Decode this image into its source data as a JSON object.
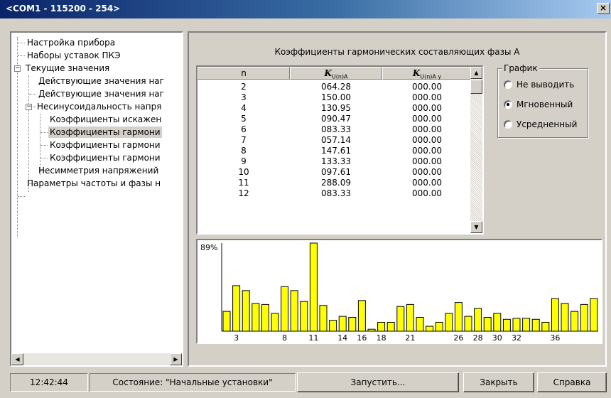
{
  "window": {
    "title": "<COM1 - 115200 - 254>",
    "close_glyph": "×"
  },
  "tree": {
    "items": [
      {
        "label": "Настройка прибора"
      },
      {
        "label": "Наборы уставок ПКЭ"
      },
      {
        "label": "Текущие значения",
        "expand": "−"
      },
      {
        "label": "Действующие значения наг"
      },
      {
        "label": "Действующие значения наг"
      },
      {
        "label": "Несинусоидальность напря",
        "expand": "−"
      },
      {
        "label": "Коэффициенты искажен"
      },
      {
        "label": "Коэффициенты гармони"
      },
      {
        "label": "Коэффициенты гармони"
      },
      {
        "label": "Коэффициенты гармони"
      },
      {
        "label": "Несимметрия напряжений"
      },
      {
        "label": "Параметры частоты и фазы н"
      }
    ],
    "selected_index": 7,
    "scroll_left": "◀",
    "scroll_right": "▶"
  },
  "panel": {
    "title": "Коэффициенты гармонических составляющих фазы А",
    "table": {
      "headers": [
        "n",
        "K",
        "K"
      ],
      "header_subs": [
        "",
        "U(n)A",
        "U(n)A у"
      ],
      "rows": [
        [
          "2",
          "064.28",
          "000.00"
        ],
        [
          "3",
          "150.00",
          "000.00"
        ],
        [
          "4",
          "130.95",
          "000.00"
        ],
        [
          "5",
          "090.47",
          "000.00"
        ],
        [
          "6",
          "083.33",
          "000.00"
        ],
        [
          "7",
          "057.14",
          "000.00"
        ],
        [
          "8",
          "147.61",
          "000.00"
        ],
        [
          "9",
          "133.33",
          "000.00"
        ],
        [
          "10",
          "097.61",
          "000.00"
        ],
        [
          "11",
          "288.09",
          "000.00"
        ],
        [
          "12",
          "083.33",
          "000.00"
        ]
      ],
      "scroll_up": "▲",
      "scroll_down": "▼"
    },
    "graph_group": {
      "legend": "График",
      "options": [
        "Не выводить",
        "Мгновенный",
        "Усредненный"
      ],
      "selected": 1
    }
  },
  "chart_data": {
    "type": "bar",
    "max_label": "89%",
    "ylim": [
      0,
      89
    ],
    "colors": {
      "bar": "#ffff00",
      "bar_border": "#000000"
    },
    "categories": [
      2,
      3,
      4,
      5,
      6,
      7,
      8,
      9,
      10,
      11,
      12,
      13,
      14,
      15,
      16,
      17,
      18,
      19,
      20,
      21,
      22,
      23,
      24,
      25,
      26,
      27,
      28,
      29,
      30,
      31,
      32,
      33,
      34,
      35,
      36,
      37,
      38,
      39,
      40
    ],
    "values": [
      20,
      46,
      41,
      28,
      27,
      18,
      45,
      41,
      30,
      89,
      26,
      11,
      15,
      14,
      31,
      2,
      9,
      9,
      25,
      27,
      14,
      5,
      9,
      18,
      29,
      15,
      23,
      14,
      18,
      12,
      13,
      13,
      12,
      9,
      33,
      28,
      20,
      27,
      33
    ],
    "tick_labels": [
      {
        "x": 3,
        "label": "3"
      },
      {
        "x": 8,
        "label": "8"
      },
      {
        "x": 11,
        "label": "11"
      },
      {
        "x": 14,
        "label": "14"
      },
      {
        "x": 16,
        "label": "16"
      },
      {
        "x": 18,
        "label": "18"
      },
      {
        "x": 21,
        "label": "21"
      },
      {
        "x": 26,
        "label": "26"
      },
      {
        "x": 28,
        "label": "28"
      },
      {
        "x": 30,
        "label": "30"
      },
      {
        "x": 32,
        "label": "32"
      },
      {
        "x": 36,
        "label": "36"
      }
    ]
  },
  "statusbar": {
    "time": "12:42:44",
    "state": "Состояние: \"Начальные установки\"",
    "run_label": "Запустить...",
    "close_label": "Закрыть",
    "help_label": "Справка"
  }
}
